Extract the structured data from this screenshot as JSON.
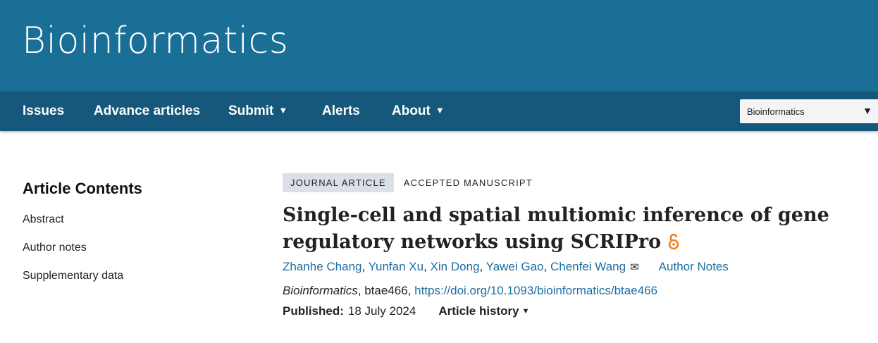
{
  "header": {
    "brand": "Bioinformatics"
  },
  "nav": {
    "issues": "Issues",
    "advance": "Advance articles",
    "submit": "Submit",
    "alerts": "Alerts",
    "about": "About",
    "caret": "▼",
    "journal_select": "Bioinformatics",
    "select_caret": "▼"
  },
  "sidebar": {
    "title": "Article Contents",
    "items": [
      {
        "label": "Abstract"
      },
      {
        "label": "Author notes"
      },
      {
        "label": "Supplementary data"
      }
    ]
  },
  "article": {
    "type_label": "JOURNAL ARTICLE",
    "status_label": "ACCEPTED MANUSCRIPT",
    "title": "Single-cell and spatial multiomic inference of gene regulatory networks using SCRIPro",
    "open_access_icon": "open-access-lock",
    "authors": [
      {
        "name": "Zhanhe Chang"
      },
      {
        "name": "Yunfan Xu"
      },
      {
        "name": "Xin Dong"
      },
      {
        "name": "Yawei Gao"
      },
      {
        "name": "Chenfei Wang"
      }
    ],
    "author_sep": ", ",
    "mail_icon": "✉",
    "author_notes": "Author Notes",
    "journal_name": "Bioinformatics",
    "article_id": ", btae466, ",
    "doi": "https://doi.org/10.1093/bioinformatics/btae466",
    "published_label": "Published:",
    "published_date": "18 July 2024",
    "history_label": "Article history",
    "history_caret": "▼"
  },
  "colors": {
    "masthead": "#1a6f96",
    "navbar": "#15587c",
    "link": "#1d6ea2",
    "open_access": "#f4801f",
    "badge": "#dbe0e6"
  }
}
